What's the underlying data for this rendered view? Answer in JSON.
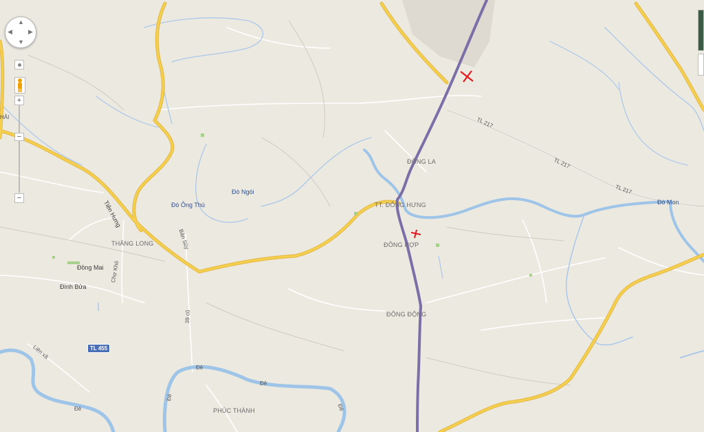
{
  "map": {
    "labels": {
      "dong_la": "ĐỒNG LA",
      "tt_dong_hung": "TT. ĐÔNG HƯNG",
      "dong_hop": "ĐÔNG HỢP",
      "dong_dong": "ĐÔNG ĐỘNG",
      "thang_long": "THĂNG LONG",
      "phuc_thanh": "PHÚC THÀNH",
      "do_ong_thu": "Đò Ông Thú",
      "do_ngoi": "Đò Ngói",
      "do_mon": "Đò Mon",
      "dong_mai": "Đồng Mai",
      "dinh_bua": "Đình Bửa",
      "cho_kho": "Chợ Khô",
      "tien_hung": "Tiên Hưng",
      "ban_suy": "Bản Sủy",
      "r39_cu": "39 cũ",
      "tl217_a": "TL 217",
      "tl217_b": "TL 217",
      "tl217_c": "TL 217",
      "lien_xa": "Liên xã",
      "de_1": "Đê",
      "de_2": "Đê",
      "de_3": "Đê",
      "de_4": "Đê",
      "de_5": "Đê",
      "hai": "HẢI"
    },
    "shield_tl455": "TL 455",
    "colors": {
      "land": "#ece9e1",
      "major_road": "#f5d04f",
      "road_outline": "#e3b742",
      "minor_road": "#ffffff",
      "river": "#9ec4e8",
      "stream": "#aac8ea",
      "route": "#7b6fa8",
      "marker": "#e0191e",
      "built_area": "#dedad1"
    },
    "markers": [
      "red-cross-marker",
      "red-cross-marker"
    ],
    "controls": {
      "zoom_in": "+",
      "zoom_out": "−",
      "pan_up": "▲",
      "pan_down": "▼",
      "pan_left": "◀",
      "pan_right": "▶"
    }
  }
}
